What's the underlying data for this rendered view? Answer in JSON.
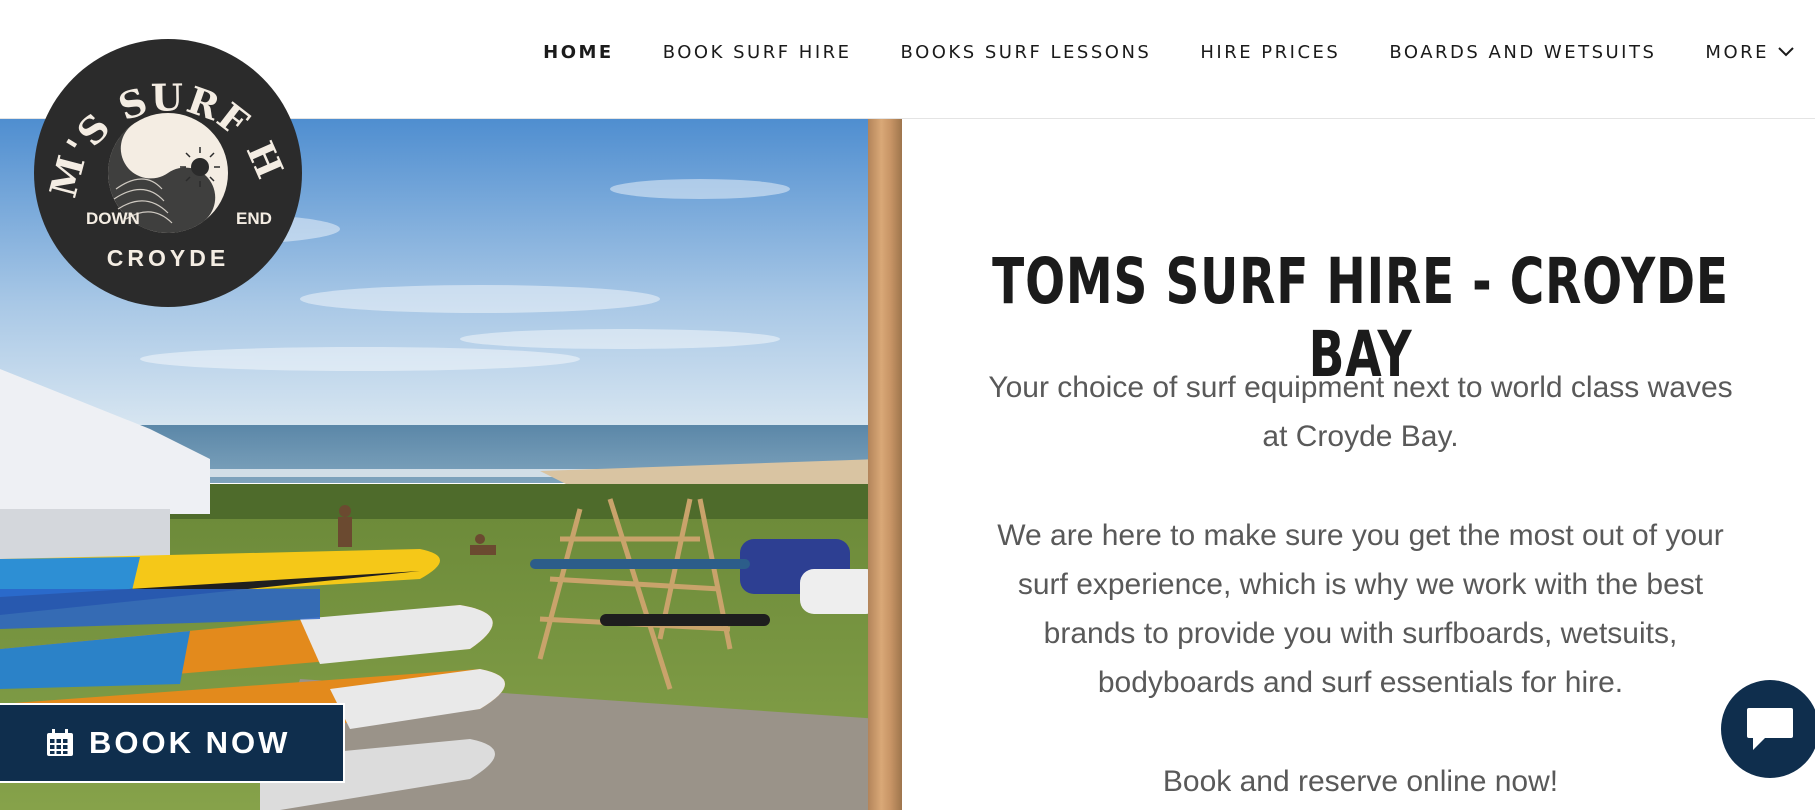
{
  "nav": {
    "items": [
      {
        "label": "HOME",
        "active": true
      },
      {
        "label": "BOOK SURF HIRE"
      },
      {
        "label": "BOOKS SURF LESSONS"
      },
      {
        "label": "HIRE PRICES"
      },
      {
        "label": "BOARDS AND WETSUITS"
      },
      {
        "label": "MORE"
      }
    ]
  },
  "logo": {
    "arc_text": "TOM'S SURF HIRE",
    "left_text": "DOWN",
    "right_text": "END",
    "bottom_text": "CROYDE",
    "icon": "wave-sun-icon"
  },
  "hero": {
    "image": "beach-surfboards-photo"
  },
  "content": {
    "title": "TOMS SURF HIRE - CROYDE BAY",
    "paragraph1": "Your choice of surf equipment next to world class waves at Croyde Bay.",
    "paragraph2": "We are here to make sure you get the most out of your surf experience, which is why we work with the best brands to provide you with surfboards, wetsuits, bodyboards and surf essentials for hire.",
    "paragraph3": "Book and reserve online now!"
  },
  "book_button": {
    "label": "BOOK NOW",
    "icon": "calendar-icon"
  },
  "chat": {
    "icon": "chat-bubble-icon"
  },
  "colors": {
    "navy": "#0f2e4d",
    "text_dark": "#1b1b1b",
    "text_grey": "#595959",
    "logo_bg": "#2b2b2b",
    "logo_cream": "#f4ede3"
  }
}
